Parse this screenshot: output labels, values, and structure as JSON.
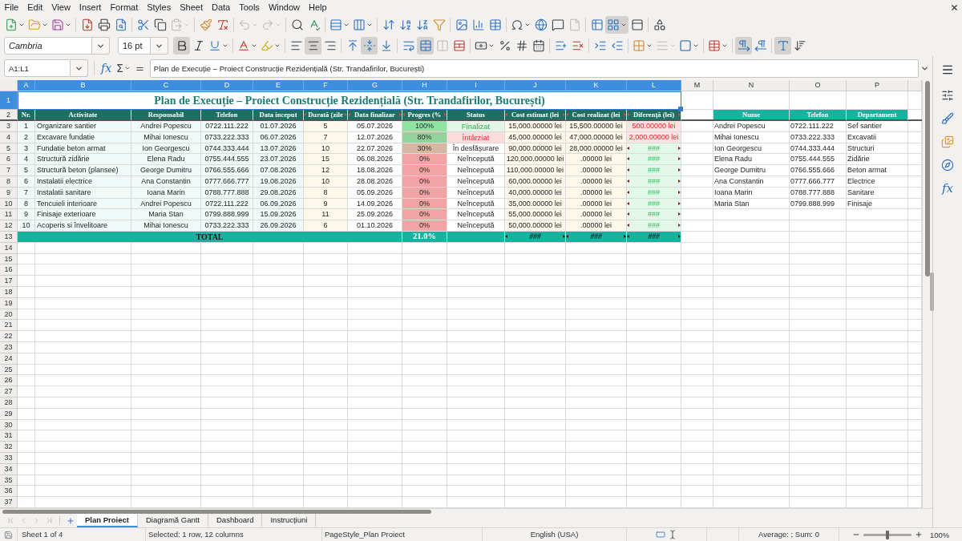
{
  "menu_bar": [
    "File",
    "Edit",
    "View",
    "Insert",
    "Format",
    "Styles",
    "Sheet",
    "Data",
    "Tools",
    "Window",
    "Help"
  ],
  "standard_toolbar": {
    "freeze_rows_columns": true
  },
  "formatting_toolbar": {
    "font_name": "Cambria",
    "font_size": "16 pt",
    "bold": true,
    "italic": false,
    "underline": false,
    "align_left": false,
    "align_center": true,
    "align_right": false,
    "align_top": false,
    "align_middle": true,
    "align_bottom": false,
    "wrap_text": false,
    "merge_and_center": true,
    "left_to_right": true,
    "right_to_left": false,
    "horizontal_text": true,
    "vertical_text": false
  },
  "formula_bar": {
    "name_box": "A1:L1",
    "function_wizard": "fx",
    "sum": "Σ",
    "formula": "=",
    "content": "Plan de Execuție – Proiect Construcție Rezidențială (Str. Trandafirilor, București)"
  },
  "sheet": {
    "columns": [
      {
        "label": "A",
        "selected": true
      },
      {
        "label": "B",
        "selected": true
      },
      {
        "label": "C",
        "selected": true
      },
      {
        "label": "D",
        "selected": true
      },
      {
        "label": "E",
        "selected": true
      },
      {
        "label": "F",
        "selected": true
      },
      {
        "label": "G",
        "selected": true
      },
      {
        "label": "H",
        "selected": true
      },
      {
        "label": "I",
        "selected": true
      },
      {
        "label": "J",
        "selected": true
      },
      {
        "label": "K",
        "selected": true
      },
      {
        "label": "L",
        "selected": true
      },
      {
        "label": "M",
        "selected": false
      },
      {
        "label": "N",
        "selected": false
      },
      {
        "label": "O",
        "selected": false
      },
      {
        "label": "P",
        "selected": false
      }
    ],
    "rows": [
      {
        "label": "1",
        "selected": true
      },
      {
        "label": "2",
        "selected": false
      },
      {
        "label": "3",
        "selected": false
      },
      {
        "label": "4",
        "selected": false
      },
      {
        "label": "5",
        "selected": false
      },
      {
        "label": "6",
        "selected": false
      },
      {
        "label": "7",
        "selected": false
      },
      {
        "label": "8",
        "selected": false
      },
      {
        "label": "9",
        "selected": false
      },
      {
        "label": "10",
        "selected": false
      },
      {
        "label": "11",
        "selected": false
      },
      {
        "label": "12",
        "selected": false
      },
      {
        "label": "13",
        "selected": false
      },
      {
        "label": "14",
        "selected": false
      },
      {
        "label": "15",
        "selected": false
      },
      {
        "label": "16",
        "selected": false
      },
      {
        "label": "17",
        "selected": false
      },
      {
        "label": "18",
        "selected": false
      },
      {
        "label": "19",
        "selected": false
      },
      {
        "label": "20",
        "selected": false
      },
      {
        "label": "21",
        "selected": false
      },
      {
        "label": "22",
        "selected": false
      },
      {
        "label": "23",
        "selected": false
      },
      {
        "label": "24",
        "selected": false
      },
      {
        "label": "25",
        "selected": false
      },
      {
        "label": "26",
        "selected": false
      },
      {
        "label": "27",
        "selected": false
      },
      {
        "label": "28",
        "selected": false
      },
      {
        "label": "29",
        "selected": false
      },
      {
        "label": "30",
        "selected": false
      },
      {
        "label": "31",
        "selected": false
      },
      {
        "label": "32",
        "selected": false
      },
      {
        "label": "33",
        "selected": false
      },
      {
        "label": "34",
        "selected": false
      },
      {
        "label": "35",
        "selected": false
      },
      {
        "label": "36",
        "selected": false
      },
      {
        "label": "37",
        "selected": false
      }
    ],
    "title": "Plan de Execuție – Proiect Construcție Rezidențială (Str. Trandafirilor, București)",
    "plan_table": {
      "headers": [
        {
          "text": "Nr.",
          "clipped": false
        },
        {
          "text": "Activitate",
          "clipped": false
        },
        {
          "text": "Responsabil",
          "clipped": false
        },
        {
          "text": "Telefon",
          "clipped": false
        },
        {
          "text": "Data inceput",
          "clipped": false
        },
        {
          "text": "Durată (zile",
          "clipped": true
        },
        {
          "text": "Data finalizar",
          "clipped": true
        },
        {
          "text": "Progres (%",
          "clipped": true
        },
        {
          "text": "Status",
          "clipped": false
        },
        {
          "text": "Cost estimat (lei",
          "clipped": true
        },
        {
          "text": "Cost realizat (lei",
          "clipped": true
        },
        {
          "text": "Diferență (lei)",
          "clipped": true
        }
      ],
      "rows": [
        {
          "nr": "1",
          "activity": "Organizare santier",
          "responsible": "Andrei Popescu",
          "phone": "0722.111.222",
          "start": "01.07.2026",
          "duration": "5",
          "end": "05.07.2026",
          "progress": {
            "text": "100%",
            "color": "#8ee4a2"
          },
          "status": {
            "text": "Finalizat",
            "kind": "done"
          },
          "cost_estimated": "15,000.00000 lei",
          "cost_actual": "15,500.00000 lei",
          "difference": {
            "text": "500.00000 lei",
            "kind": "overrun",
            "clipped": false
          }
        },
        {
          "nr": "2",
          "activity": "Excavare fundatie",
          "responsible": "Mihai Ionescu",
          "phone": "0733.222.333",
          "start": "06.07.2026",
          "duration": "7",
          "end": "12.07.2026",
          "progress": {
            "text": "80%",
            "color": "#92d39d"
          },
          "status": {
            "text": "Întârziat",
            "kind": "late"
          },
          "cost_estimated": "45,000.00000 lei",
          "cost_actual": "47,000.00000 lei",
          "difference": {
            "text": "2,000.00000 lei",
            "kind": "overrun",
            "clipped": false
          }
        },
        {
          "nr": "3",
          "activity": "Fundatie beton armat",
          "responsible": "Ion Georgescu",
          "phone": "0744.333.444",
          "start": "13.07.2026",
          "duration": "10",
          "end": "22.07.2026",
          "progress": {
            "text": "30%",
            "color": "#d6b7a1"
          },
          "status": {
            "text": "În desfășurare",
            "kind": "in_progress"
          },
          "cost_estimated": "90,000.00000 lei",
          "cost_actual": "28,000.00000 lei",
          "difference": {
            "text": "###",
            "kind": "saving",
            "clipped": true
          }
        },
        {
          "nr": "4",
          "activity": "Structură zidărie",
          "responsible": "Elena Radu",
          "phone": "0755.444.555",
          "start": "23.07.2026",
          "duration": "15",
          "end": "06.08.2026",
          "progress": {
            "text": "0%",
            "color": "#f2a3a3"
          },
          "status": {
            "text": "Neîncepută",
            "kind": "not_started"
          },
          "cost_estimated": "120,000.00000 lei",
          "cost_actual": ".00000 lei",
          "difference": {
            "text": "###",
            "kind": "saving",
            "clipped": true
          }
        },
        {
          "nr": "5",
          "activity": "Structură beton (plansee)",
          "responsible": "George Dumitru",
          "phone": "0766.555.666",
          "start": "07.08.2026",
          "duration": "12",
          "end": "18.08.2026",
          "progress": {
            "text": "0%",
            "color": "#f2a3a3"
          },
          "status": {
            "text": "Neîncepută",
            "kind": "not_started"
          },
          "cost_estimated": "110,000.00000 lei",
          "cost_actual": ".00000 lei",
          "difference": {
            "text": "###",
            "kind": "saving",
            "clipped": true
          }
        },
        {
          "nr": "6",
          "activity": "Instalatii electrice",
          "responsible": "Ana Constantin",
          "phone": "0777.666.777",
          "start": "19.08.2026",
          "duration": "10",
          "end": "28.08.2026",
          "progress": {
            "text": "0%",
            "color": "#f2a3a3"
          },
          "status": {
            "text": "Neîncepută",
            "kind": "not_started"
          },
          "cost_estimated": "60,000.00000 lei",
          "cost_actual": ".00000 lei",
          "difference": {
            "text": "###",
            "kind": "saving",
            "clipped": true
          }
        },
        {
          "nr": "7",
          "activity": "Instalatii sanitare",
          "responsible": "Ioana Marin",
          "phone": "0788.777.888",
          "start": "29.08.2026",
          "duration": "8",
          "end": "05.09.2026",
          "progress": {
            "text": "0%",
            "color": "#f2a3a3"
          },
          "status": {
            "text": "Neîncepută",
            "kind": "not_started"
          },
          "cost_estimated": "40,000.00000 lei",
          "cost_actual": ".00000 lei",
          "difference": {
            "text": "###",
            "kind": "saving",
            "clipped": true
          }
        },
        {
          "nr": "8",
          "activity": "Tencuieli interioare",
          "responsible": "Andrei Popescu",
          "phone": "0722.111.222",
          "start": "06.09.2026",
          "duration": "9",
          "end": "14.09.2026",
          "progress": {
            "text": "0%",
            "color": "#f2a3a3"
          },
          "status": {
            "text": "Neîncepută",
            "kind": "not_started"
          },
          "cost_estimated": "35,000.00000 lei",
          "cost_actual": ".00000 lei",
          "difference": {
            "text": "###",
            "kind": "saving",
            "clipped": true
          }
        },
        {
          "nr": "9",
          "activity": "Finisaje exterioare",
          "responsible": "Maria Stan",
          "phone": "0799.888.999",
          "start": "15.09.2026",
          "duration": "11",
          "end": "25.09.2026",
          "progress": {
            "text": "0%",
            "color": "#f2a3a3"
          },
          "status": {
            "text": "Neîncepută",
            "kind": "not_started"
          },
          "cost_estimated": "55,000.00000 lei",
          "cost_actual": ".00000 lei",
          "difference": {
            "text": "###",
            "kind": "saving",
            "clipped": true
          }
        },
        {
          "nr": "10",
          "activity": "Acoperis si învelitoare",
          "responsible": "Mihai Ionescu",
          "phone": "0733.222.333",
          "start": "26.09.2026",
          "duration": "6",
          "end": "01.10.2026",
          "progress": {
            "text": "0%",
            "color": "#f2a3a3"
          },
          "status": {
            "text": "Neîncepută",
            "kind": "not_started"
          },
          "cost_estimated": "50,000.00000 lei",
          "cost_actual": ".00000 lei",
          "difference": {
            "text": "###",
            "kind": "saving",
            "clipped": true
          }
        }
      ],
      "total": {
        "label": "TOTAL",
        "progress": "21.0%",
        "cost_estimated": {
          "text": "###",
          "clipped": true
        },
        "cost_actual": {
          "text": "###",
          "clipped": true
        },
        "difference": {
          "text": "###",
          "clipped": true
        }
      }
    },
    "team_table": {
      "headers": [
        "Nume",
        "Telefon",
        "Departament"
      ],
      "rows": [
        [
          "Andrei Popescu",
          "0722.111.222",
          "Sef santier"
        ],
        [
          "Mihai Ionescu",
          "0733.222.333",
          "Excavatii"
        ],
        [
          "Ion Georgescu",
          "0744.333.444",
          "Structuri"
        ],
        [
          "Elena Radu",
          "0755.444.555",
          "Zidărie"
        ],
        [
          "George Dumitru",
          "0766.555.666",
          "Beton armat"
        ],
        [
          "Ana Constantin",
          "0777.666.777",
          "Electrice"
        ],
        [
          "Ioana Marin",
          "0788.777.888",
          "Sanitare"
        ],
        [
          "Maria Stan",
          "0799.888.999",
          "Finisaje"
        ]
      ]
    }
  },
  "sheet_tabs": [
    {
      "label": "Plan Proiect",
      "selected": true
    },
    {
      "label": "Diagramă Gantt",
      "selected": false
    },
    {
      "label": "Dashboard",
      "selected": false
    },
    {
      "label": "Instrucțiuni",
      "selected": false
    }
  ],
  "sidebar": {
    "functions": "fx"
  },
  "status_bar": {
    "sheet": "Sheet 1 of 4",
    "selection": "Selected: 1 row, 12 columns",
    "page_style": "PageStyle_Plan Proiect",
    "language": "English (USA)",
    "summary": "Average: ; Sum: 0",
    "zoom_slider": {
      "level": 0.5
    },
    "zoom": "100%"
  }
}
